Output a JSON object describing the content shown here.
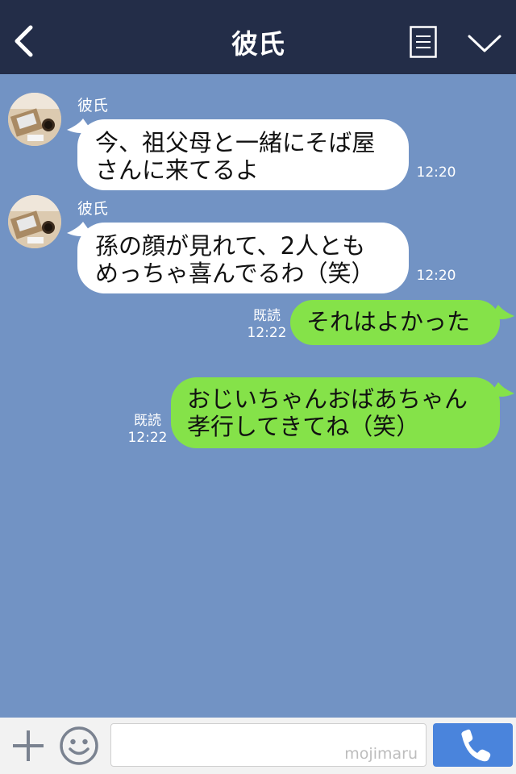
{
  "header": {
    "title": "彼氏"
  },
  "messages": [
    {
      "side": "in",
      "sender": "彼氏",
      "lines": [
        "今、祖父母と一緒にそば屋",
        "さんに来てるよ"
      ],
      "time": "12:20"
    },
    {
      "side": "in",
      "sender": "彼氏",
      "lines": [
        "孫の顔が見れて、2人とも",
        "めっちゃ喜んでるわ（笑）"
      ],
      "time": "12:20"
    },
    {
      "side": "out",
      "read": "既読",
      "lines": [
        "それはよかった"
      ],
      "time": "12:22"
    },
    {
      "side": "out",
      "read": "既読",
      "lines": [
        "おじいちゃんおばあちゃん",
        "孝行してきてね（笑）"
      ],
      "time": "12:22"
    }
  ],
  "input": {
    "placeholder": "",
    "watermark": "mojimaru"
  },
  "colors": {
    "header": "#232d48",
    "chat_bg": "#7293c4",
    "incoming": "#ffffff",
    "outgoing": "#85e249",
    "call": "#4a84dc"
  },
  "icons": [
    "back-arrow-icon",
    "menu-list-icon",
    "chevron-down-icon",
    "plus-icon",
    "smiley-icon",
    "phone-icon"
  ]
}
